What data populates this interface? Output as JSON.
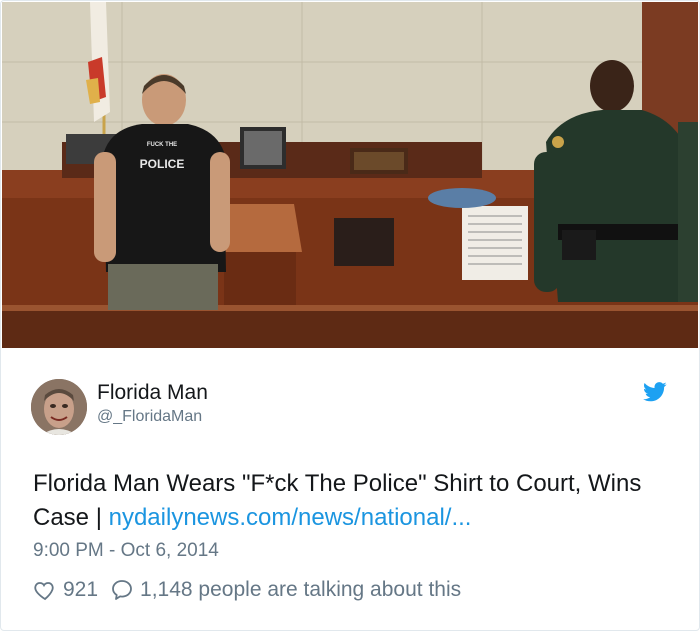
{
  "image": {
    "shirt_top_text": "FUCK THE",
    "shirt_text": "POLICE"
  },
  "tweet": {
    "author_name": "Florida Man",
    "author_handle": "@_FloridaMan",
    "text": "Florida Man Wears \"F*ck The Police\" Shirt to Court, Wins Case | ",
    "link_text": "nydailynews.com/news/national/...",
    "timestamp": "9:00 PM - Oct 6, 2014",
    "likes": "921",
    "conversation": "1,148 people are talking about this"
  },
  "icons": {
    "brand": "twitter-bird-icon",
    "like": "heart-icon",
    "reply": "speech-bubble-icon"
  },
  "colors": {
    "link": "#1b95e0",
    "twitter_blue": "#1da1f2",
    "muted": "#657786",
    "text": "#14171a"
  }
}
